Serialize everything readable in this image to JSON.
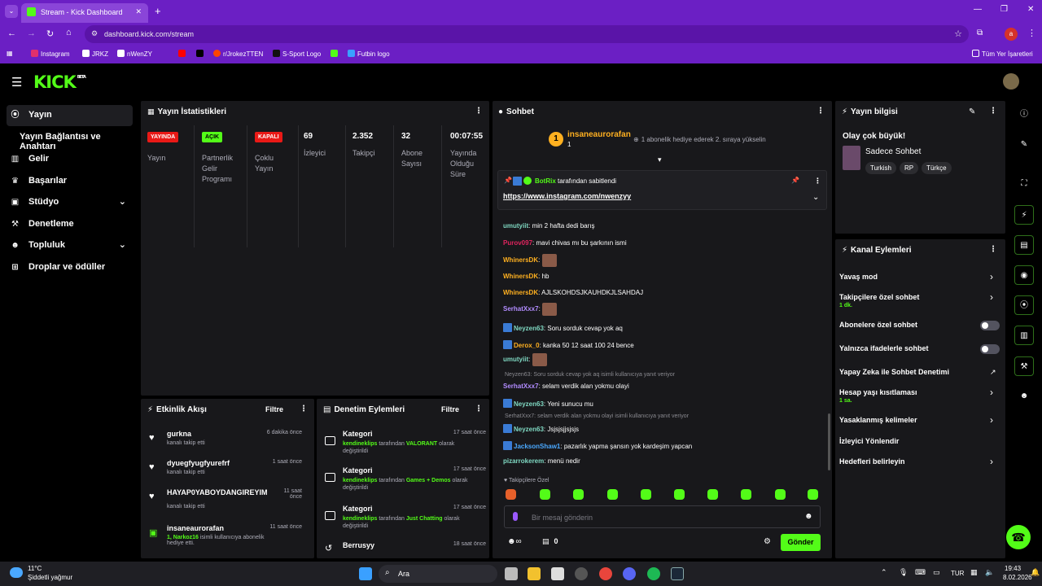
{
  "browser": {
    "tab_title": "Stream - Kick Dashboard",
    "url": "dashboard.kick.com/stream",
    "profile_initial": "a",
    "bookmarks": [
      "Instagram",
      "JRKZ",
      "nWenZY",
      "",
      "r/JrokezTTEN",
      "S-Sport Logo",
      "",
      "Futbin logo"
    ],
    "all_bookmarks": "Tüm Yer İşaretleri"
  },
  "brand": {
    "logo": "KICK",
    "beta": "BETA"
  },
  "sidebar": {
    "items": [
      "Yayın",
      "Yayın Bağlantısı ve Anahtarı",
      "Gelir",
      "Başarılar",
      "Stüdyo",
      "Denetleme",
      "Topluluk",
      "Droplar ve ödüller"
    ]
  },
  "stats": {
    "title": "Yayın İstatistikleri",
    "cols": [
      {
        "badge": "YAYINDA",
        "label": "Yayın"
      },
      {
        "badge": "AÇIK",
        "label": "Partnerlik Gelir Programı"
      },
      {
        "badge": "KAPALI",
        "label": "Çoklu Yayın"
      },
      {
        "value": "69",
        "label": "İzleyici"
      },
      {
        "value": "2.352",
        "label": "Takipçi"
      },
      {
        "value": "32",
        "label": "Abone Sayısı"
      },
      {
        "value": "00:07:55",
        "label": "Yayında Olduğu Süre"
      }
    ]
  },
  "activity": {
    "title": "Etkinlik Akışı",
    "filter": "Filtre",
    "items": [
      {
        "name": "gurkna",
        "sub": "kanalı takip etti",
        "time": "6 dakika önce"
      },
      {
        "name": "dyuegfyugfyurefrf",
        "sub": "kanalı takip etti",
        "time": "1 saat önce"
      },
      {
        "name": "HAYAP0YABOYDANGIREYIM",
        "sub": "kanalı takip etti",
        "time": "11 saat önce"
      },
      {
        "name": "insaneaurorafan",
        "sub_green": "1, Narkoz16",
        "sub": " isimli kullanıcıya abonelik hediye etti.",
        "time": "11 saat önce"
      }
    ]
  },
  "moderation": {
    "title": "Denetim Eylemleri",
    "filter": "Filtre",
    "items": [
      {
        "name": "Kategori",
        "user": "kendineklips",
        "mid": " tarafından ",
        "cat": "VALORANT",
        "end": " olarak değiştirildi",
        "time": "17 saat önce"
      },
      {
        "name": "Kategori",
        "user": "kendineklips",
        "mid": " tarafından ",
        "cat": "Games + Demos",
        "end": " olarak değiştirildi",
        "time": "17 saat önce"
      },
      {
        "name": "Kategori",
        "user": "kendineklips",
        "mid": " tarafından ",
        "cat": "Just Chatting",
        "end": " olarak değiştirildi",
        "time": "17 saat önce"
      },
      {
        "name": "Berrusyy",
        "time": "18 saat önce"
      }
    ]
  },
  "chat": {
    "title": "Sohbet",
    "top_user": "insaneaurorafan",
    "top_count": "1",
    "gift_text": "1 abonelik hediye ederek 2. sıraya yükselin",
    "pinned": {
      "by": "BotRix",
      "by_suffix": "tarafından sabitlendi",
      "link": "https://www.instagram.com/nwenzyy"
    },
    "messages": [
      {
        "user": "umutyiit",
        "color": "#7fd8c2",
        "text": "min 2 hafta dedi barış"
      },
      {
        "user": "Purov097",
        "color": "#e0245e",
        "text": "mavi chivas mı bu şarkının ismi"
      },
      {
        "user": "WhinersDK",
        "color": "#ffb020",
        "text": "",
        "emote": true
      },
      {
        "user": "WhinersDK",
        "color": "#ffb020",
        "text": "hb"
      },
      {
        "user": "WhinersDK",
        "color": "#ffb020",
        "text": "AJLSKOHDSJKAUHDKJLSAHDAJ"
      },
      {
        "user": "SerhatXxx7",
        "color": "#b28cff",
        "text": "",
        "emote": true
      },
      {
        "user": "Neyzen63",
        "color": "#7fd8c2",
        "text": "Soru sorduk cevap yok aq",
        "badge": true
      },
      {
        "user": "Derox_0",
        "color": "#ffb020",
        "text": "kanka 50 12 saat 100 24 bence",
        "badge": true
      },
      {
        "user": "umutyiit",
        "color": "#7fd8c2",
        "text": "",
        "emote": true
      },
      {
        "reply": "Neyzen63: Soru sorduk cevap yok aq isimli kullanıcıya yanıt veriyor"
      },
      {
        "user": "SerhatXxx7",
        "color": "#b28cff",
        "text": "selam verdik alan yokmu olayi"
      },
      {
        "user": "Neyzen63",
        "color": "#7fd8c2",
        "text": "Yeni sunucu mu",
        "badge": true
      },
      {
        "reply": "SerhatXxx7: selam verdik alan yokmu olayi isimli kullanıcıya yanıt veriyor"
      },
      {
        "user": "Neyzen63",
        "color": "#7fd8c2",
        "text": "Jsjsjsjjsjsjs",
        "badge": true
      },
      {
        "user": "JacksonShaw1",
        "color": "#4aa8ff",
        "text": "pazarlık yapma şansın yok kardeşim yapcan",
        "badge": true
      },
      {
        "user": "pizarrokerem",
        "color": "#7fd8c2",
        "text": "menü nedir"
      }
    ],
    "follower_emotes": "Takipçilere Özel",
    "placeholder": "Bir mesaj gönderin",
    "points": "0",
    "send": "Gönder"
  },
  "stream_info": {
    "title": "Yayın bilgisi",
    "headline": "Olay çok büyük!",
    "category": "Sadece Sohbet",
    "tags": [
      "Turkish",
      "RP",
      "Türkçe"
    ]
  },
  "channel_actions": {
    "title": "Kanal Eylemleri",
    "items": [
      {
        "label": "Yavaş mod",
        "kind": "arrow"
      },
      {
        "label": "Takipçilere özel sohbet",
        "sub": "1 dk.",
        "kind": "arrow"
      },
      {
        "label": "Abonelere özel sohbet",
        "kind": "toggle"
      },
      {
        "label": "Yalnızca ifadelerle sohbet",
        "kind": "toggle"
      },
      {
        "label": "Yapay Zeka ile Sohbet Denetimi",
        "kind": "ext"
      },
      {
        "label": "Hesap yaşı kısıtlaması",
        "sub": "1 sa.",
        "kind": "arrow"
      },
      {
        "label": "Yasaklanmış kelimeler",
        "kind": "arrow"
      },
      {
        "label": "İzleyici Yönlendir",
        "kind": "none"
      },
      {
        "label": "Hedefleri belirleyin",
        "kind": "arrow"
      }
    ]
  },
  "taskbar": {
    "weather_temp": "11°C",
    "weather_desc": "Şiddetli yağmur",
    "search": "Ara",
    "lang": "TUR",
    "time": "19:43",
    "date": "8.02.2026"
  },
  "colors": {
    "accent": "#53fc18",
    "live": "#e91916",
    "panel": "#18181b",
    "browser": "#6b1fc4"
  }
}
